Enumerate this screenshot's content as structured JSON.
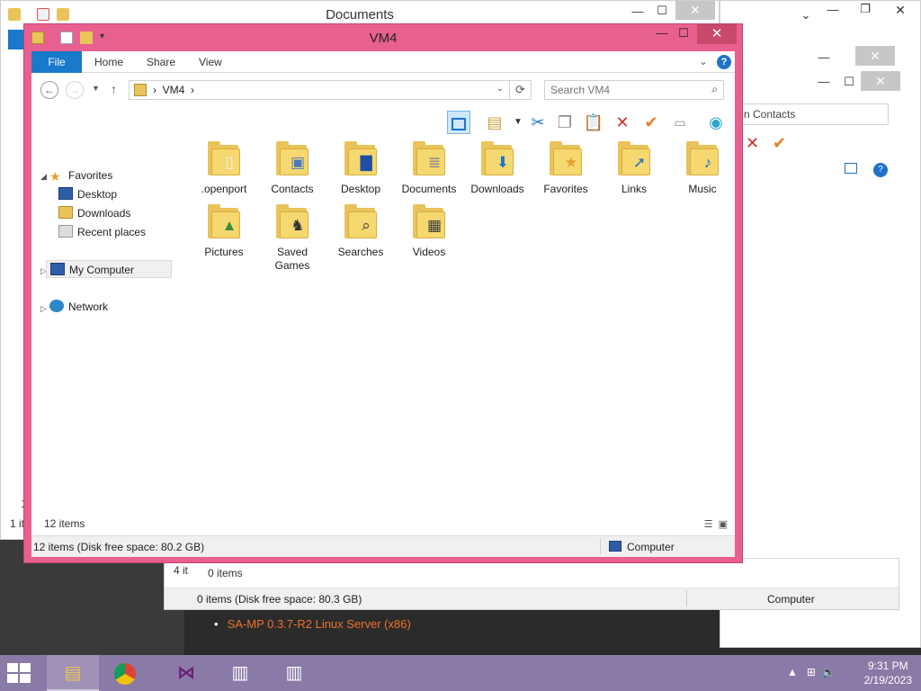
{
  "background_window": {
    "title": "Documents",
    "left_count": "1 it",
    "left_number": "1"
  },
  "contacts_window": {
    "search_placeholder": "n Contacts"
  },
  "third_window": {
    "left_count": "4 it",
    "items_text": "0 items",
    "status_left": "0 items (Disk free space: 80.3 GB)",
    "status_right": "Computer"
  },
  "web_link": "SA-MP 0.3.7-R2 Linux Server (x86)",
  "main_window": {
    "title": "VM4",
    "controls": {
      "minimize": "—",
      "maximize": "☐",
      "close": "✕"
    },
    "ribbon_tabs": [
      {
        "label": "File"
      },
      {
        "label": "Home"
      },
      {
        "label": "Share"
      },
      {
        "label": "View"
      }
    ],
    "help_label": "?",
    "address": {
      "crumb": "VM4",
      "separator": "›"
    },
    "search_placeholder": "Search VM4",
    "nav_pane": {
      "favorites": "Favorites",
      "favorites_items": [
        "Desktop",
        "Downloads",
        "Recent places"
      ],
      "my_computer": "My Computer",
      "network": "Network"
    },
    "files": [
      {
        "label": ".openport",
        "icon": "document-icon"
      },
      {
        "label": "Contacts",
        "icon": "contact-card-icon"
      },
      {
        "label": "Desktop",
        "icon": "monitor-icon"
      },
      {
        "label": "Documents",
        "icon": "page-icon"
      },
      {
        "label": "Downloads",
        "icon": "download-arrow-icon"
      },
      {
        "label": "Favorites",
        "icon": "star-icon"
      },
      {
        "label": "Links",
        "icon": "link-arrow-icon"
      },
      {
        "label": "Music",
        "icon": "music-note-icon"
      },
      {
        "label": "Pictures",
        "icon": "landscape-icon"
      },
      {
        "label": "Saved Games",
        "icon": "chess-piece-icon"
      },
      {
        "label": "Searches",
        "icon": "magnifier-icon"
      },
      {
        "label": "Videos",
        "icon": "film-icon"
      }
    ],
    "item_count": "12 items",
    "status_left": "12 items (Disk free space: 80.2 GB)",
    "status_right": "Computer"
  },
  "taskbar": {
    "time": "9:31 PM",
    "date": "2/19/2023",
    "apps": [
      "file-explorer",
      "chrome",
      "visual-studio",
      "app-window",
      "app-window"
    ]
  },
  "colors": {
    "window_frame": "#e8608f",
    "accent_blue": "#1979ca",
    "taskbar": "#8a7aa7"
  }
}
